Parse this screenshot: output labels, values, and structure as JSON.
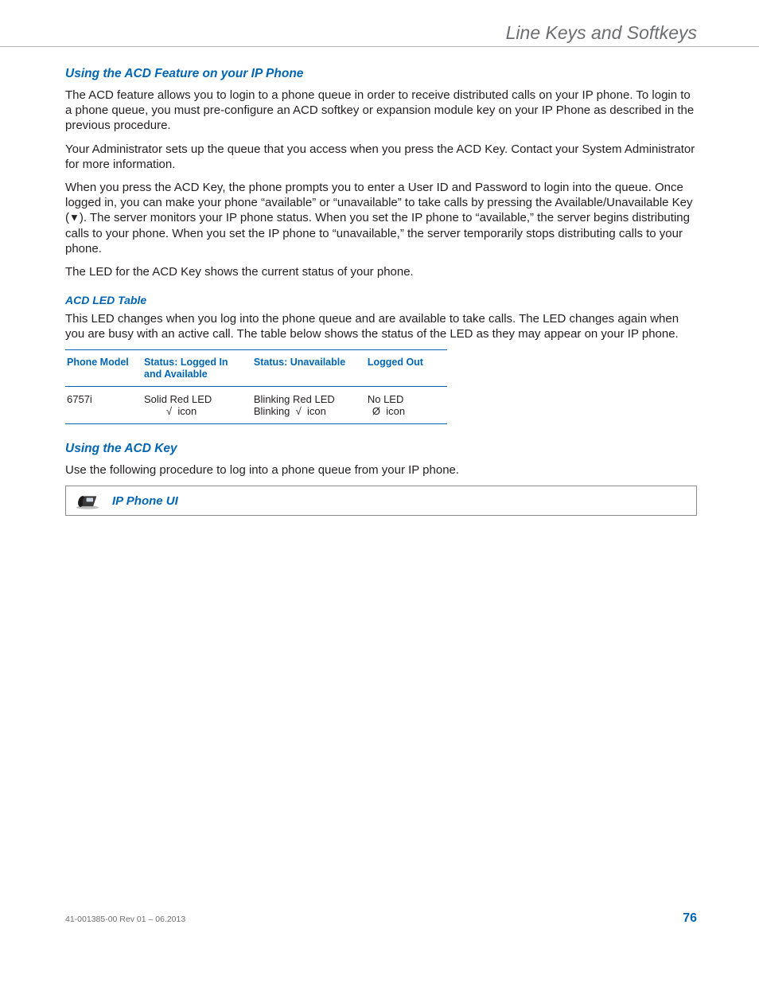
{
  "header": {
    "title": "Line Keys and Softkeys"
  },
  "sections": {
    "s1": {
      "heading": "Using the ACD Feature on your IP Phone",
      "p1a": "The ACD feature allows you to login to a phone queue in order to receive distributed calls on your IP phone. To login to a phone queue, you must pre-configure an ACD softkey or expansion module key on your IP Phone as described in the previous procedure.",
      "p2": "Your Administrator sets up the queue that you access when you press the ACD Key. Contact your System Administrator for more information.",
      "p3a": "When you press the ACD Key, the phone prompts you to enter a User ID and Password to login into the queue. Once logged in, you can make your phone “available” or “unavailable” to take calls by pressing the Available/Unavailable Key (",
      "p3b": "). The server monitors your IP phone status. When you set the IP phone to “available,” the server begins distributing calls to your phone. When you set the IP phone to “unavailable,” the server temporarily stops distributing calls to your phone.",
      "p4": "The LED for the ACD Key shows the current status of your phone."
    },
    "s2": {
      "heading": "ACD LED Table",
      "p1": "This LED changes when you log into the phone queue and are available to take calls. The LED changes again when you are busy with an active call. The table below shows the status of the LED as they may appear on your IP phone."
    },
    "table": {
      "h1": "Phone Model",
      "h2": "Status: Logged In and Available",
      "h3": "Status: Unavailable",
      "h4": "Logged Out",
      "r1c1": "6757i",
      "r1c2a": "Solid Red LED",
      "r1c2b": "icon",
      "r1c3a": "Blinking Red LED",
      "r1c3b_pre": "Blinking",
      "r1c3b_post": "icon",
      "r1c4a": "No LED",
      "r1c4b": "icon"
    },
    "s3": {
      "heading": "Using the ACD Key",
      "p1": "Use the following procedure to log into a phone queue from your IP phone.",
      "callout": "IP Phone UI"
    }
  },
  "footer": {
    "left": "41-001385-00 Rev 01 – 06.2013",
    "page": "76"
  },
  "icons": {
    "triangle_down": "▼",
    "check": "√",
    "nullset": "Ø"
  }
}
